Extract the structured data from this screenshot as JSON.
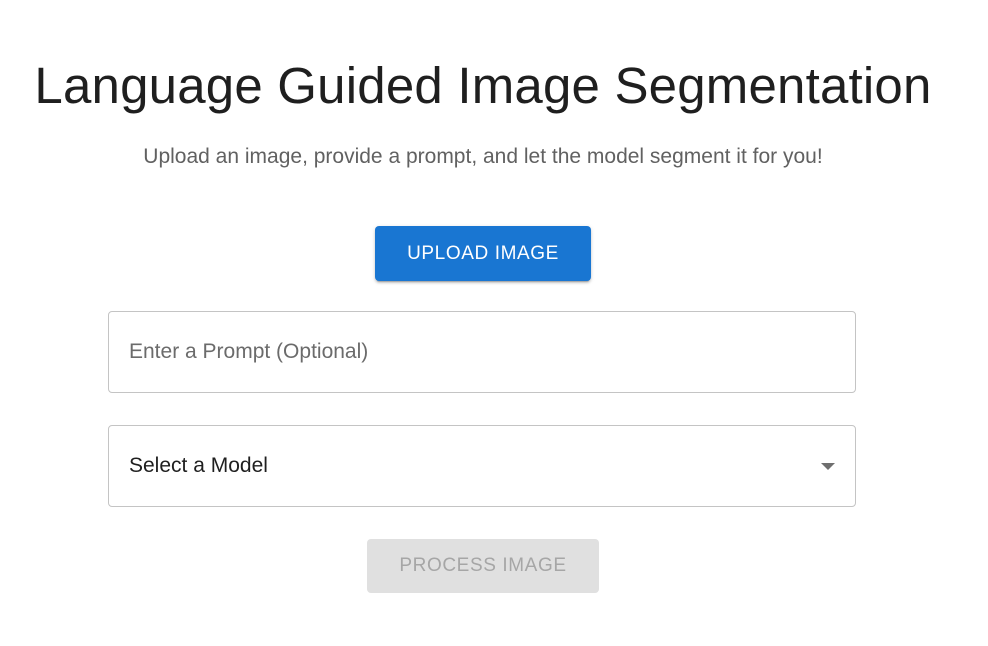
{
  "header": {
    "title": "Language Guided Image Segmentation",
    "subtitle": "Upload an image, provide a prompt, and let the model segment it for you!"
  },
  "form": {
    "upload_label": "UPLOAD IMAGE",
    "prompt": {
      "placeholder": "Enter a Prompt (Optional)",
      "value": ""
    },
    "model_select": {
      "selected": "Select a Model",
      "icon": "chevron-down-icon"
    },
    "process_label": "PROCESS IMAGE",
    "process_disabled": true
  },
  "colors": {
    "primary": "#1976d2",
    "disabled_bg": "#e0e0e0",
    "disabled_text": "#a6a6a6",
    "border": "#c4c4c4"
  }
}
